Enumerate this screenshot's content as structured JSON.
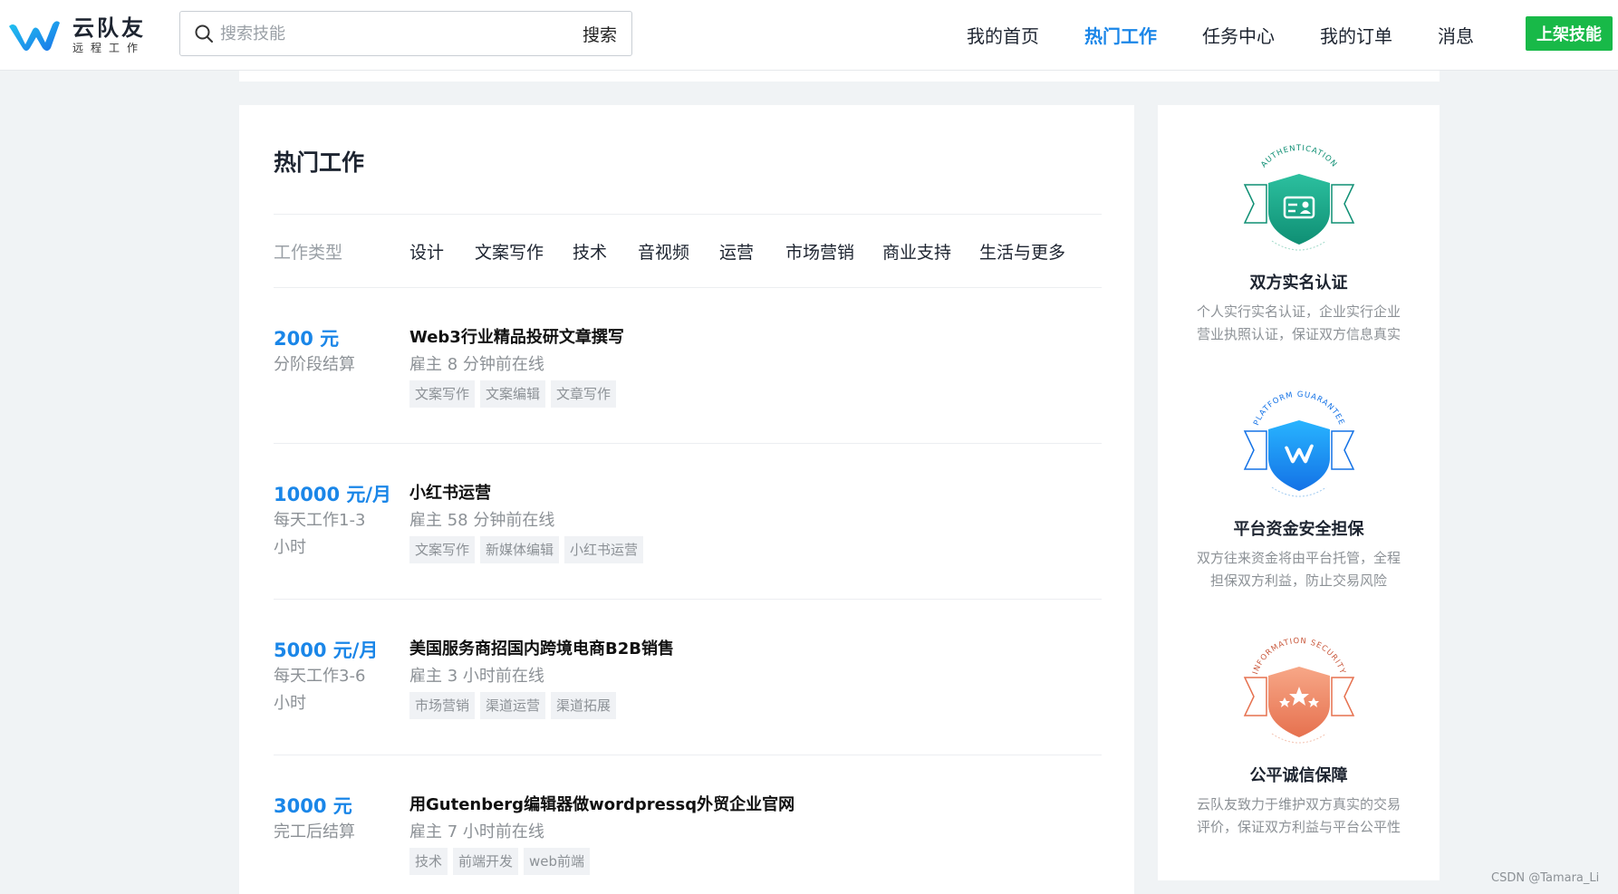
{
  "header": {
    "logo_name": "云队友",
    "logo_sub": "远程工作",
    "search_placeholder": "搜索技能",
    "search_button": "搜索",
    "nav": [
      "我的首页",
      "热门工作",
      "任务中心",
      "我的订单",
      "消息"
    ],
    "active_nav": "热门工作",
    "cta": "上架技能"
  },
  "main": {
    "title": "热门工作",
    "filter_label": "工作类型",
    "filters": [
      "设计",
      "文案写作",
      "技术",
      "音视频",
      "运营",
      "市场营销",
      "商业支持",
      "生活与更多"
    ],
    "jobs": [
      {
        "price": "200 元",
        "settle": "分阶段结算",
        "title": "Web3行业精品投研文章撰写",
        "online": "雇主 8 分钟前在线",
        "tags": [
          "文案写作",
          "文案编辑",
          "文章写作"
        ]
      },
      {
        "price": "10000 元/月",
        "settle": "每天工作1-3 小时",
        "title": "小红书运营",
        "online": "雇主 58 分钟前在线",
        "tags": [
          "文案写作",
          "新媒体编辑",
          "小红书运营"
        ]
      },
      {
        "price": "5000 元/月",
        "settle": "每天工作3-6 小时",
        "title": "美国服务商招国内跨境电商B2B销售",
        "online": "雇主 3 小时前在线",
        "tags": [
          "市场营销",
          "渠道运营",
          "渠道拓展"
        ]
      },
      {
        "price": "3000 元",
        "settle": "完工后结算",
        "title": "用Gutenberg编辑器做wordpressq外贸企业官网",
        "online": "雇主 7 小时前在线",
        "tags": [
          "技术",
          "前端开发",
          "web前端"
        ]
      }
    ]
  },
  "sidebar": {
    "features": [
      {
        "arc_text": "AUTHENTICATION",
        "title": "双方实名认证",
        "desc": "个人实行实名认证，企业实行企业营业执照认证，保证双方信息真实",
        "icon": "id-card-icon",
        "color": "#14a58a"
      },
      {
        "arc_text": "PLATFORM GUARANTEE",
        "title": "平台资金安全担保",
        "desc": "双方往来资金将由平台托管，全程担保双方利益，防止交易风险",
        "icon": "logo-w-icon",
        "color": "#1a8df0"
      },
      {
        "arc_text": "INFORMATION SECURITY",
        "title": "公平诚信保障",
        "desc": "云队友致力于维护双方真实的交易评价，保证双方利益与平台公平性",
        "icon": "stars-icon",
        "color": "#ee8a6a"
      }
    ]
  },
  "watermark": "CSDN @Tamara_Li",
  "colors": {
    "accent": "#1a86e8",
    "cta": "#18b948",
    "background": "#f0f3f5"
  }
}
